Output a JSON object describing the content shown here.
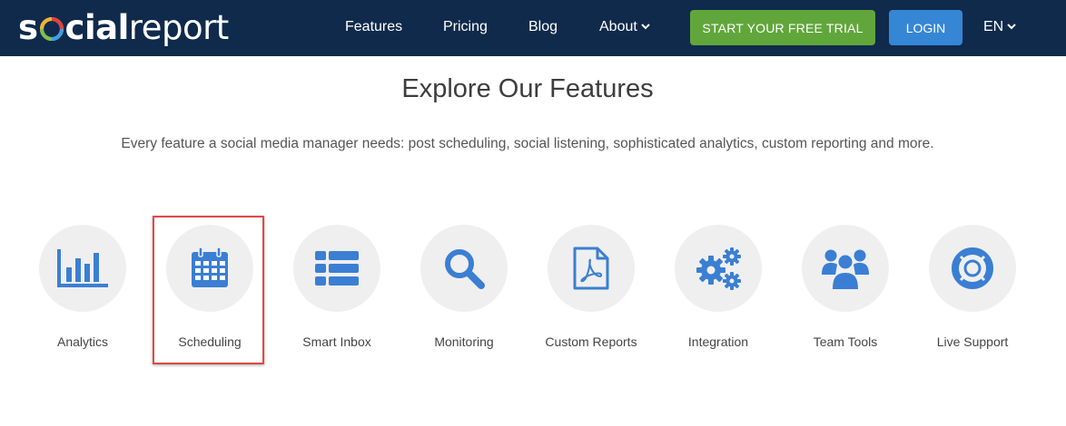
{
  "brand": {
    "logo_text_bold_1": "s",
    "logo_text_bold_2": "cial",
    "logo_text_light": "report"
  },
  "nav": {
    "features": "Features",
    "pricing": "Pricing",
    "blog": "Blog",
    "about": "About",
    "trial_button": "START YOUR FREE TRIAL",
    "login_button": "LOGIN",
    "language": "EN"
  },
  "colors": {
    "nav_bg": "#102a4c",
    "trial_green": "#61a63b",
    "login_blue": "#3686d6",
    "icon_blue": "#3a7fd3",
    "highlight_red": "#e04848"
  },
  "main": {
    "title": "Explore Our Features",
    "subtitle": "Every feature a social media manager needs: post scheduling, social listening, sophisticated analytics, custom reporting and more."
  },
  "features": [
    {
      "label": "Analytics",
      "icon": "bar-chart-icon"
    },
    {
      "label": "Scheduling",
      "icon": "calendar-icon",
      "highlighted": true
    },
    {
      "label": "Smart Inbox",
      "icon": "list-icon"
    },
    {
      "label": "Monitoring",
      "icon": "search-icon"
    },
    {
      "label": "Custom Reports",
      "icon": "pdf-file-icon"
    },
    {
      "label": "Integration",
      "icon": "gears-icon"
    },
    {
      "label": "Team Tools",
      "icon": "users-icon"
    },
    {
      "label": "Live Support",
      "icon": "life-ring-icon"
    }
  ]
}
